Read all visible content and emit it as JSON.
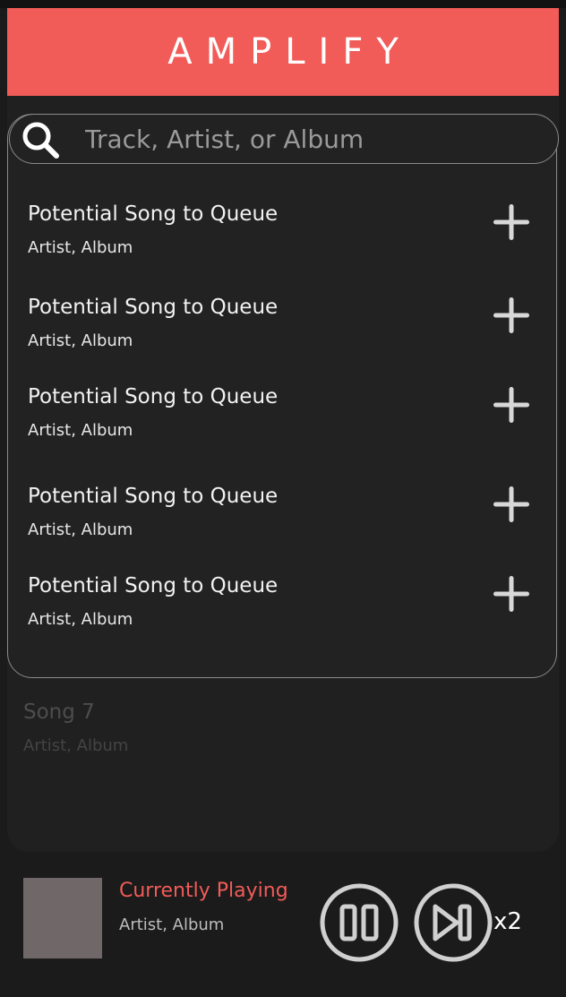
{
  "app": {
    "title": "AMPLIFY"
  },
  "search": {
    "placeholder": "Track, Artist, or Album"
  },
  "results": [
    {
      "title": "Potential Song to Queue",
      "subtitle": "Artist, Album"
    },
    {
      "title": "Potential Song to Queue",
      "subtitle": "Artist, Album"
    },
    {
      "title": "Potential Song to Queue",
      "subtitle": "Artist, Album"
    },
    {
      "title": "Potential Song to Queue",
      "subtitle": "Artist, Album"
    },
    {
      "title": "Potential Song to Queue",
      "subtitle": "Artist, Album"
    }
  ],
  "queue": [
    {
      "title": "Song 7",
      "subtitle": "Artist, Album"
    }
  ],
  "now_playing": {
    "title": "Currently Playing",
    "subtitle": "Artist, Album",
    "speed": "x2"
  },
  "icons": {
    "search": "search-icon",
    "add": "plus-icon",
    "pause": "pause-icon",
    "skip": "skip-next-icon"
  },
  "colors": {
    "accent": "#f15b58",
    "background": "#1b1b1b",
    "panel": "#202020",
    "album_art": "#706868"
  }
}
